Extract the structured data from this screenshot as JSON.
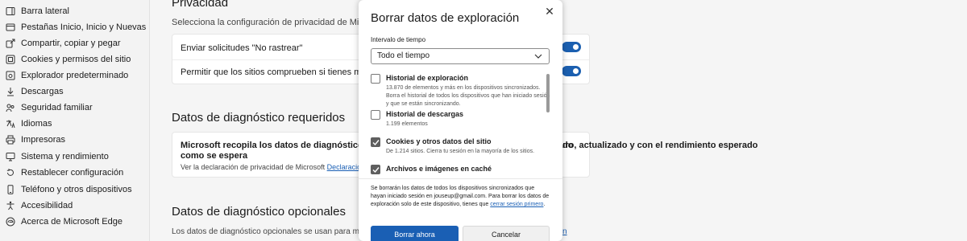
{
  "sidebar": {
    "items": [
      {
        "label": "Barra lateral",
        "icon": "sidebar-icon"
      },
      {
        "label": "Pestañas Inicio, Inicio y Nuevas",
        "icon": "home-icon"
      },
      {
        "label": "Compartir, copiar y pegar",
        "icon": "share-icon"
      },
      {
        "label": "Cookies y permisos del sitio",
        "icon": "cookie-icon"
      },
      {
        "label": "Explorador predeterminado",
        "icon": "browser-icon"
      },
      {
        "label": "Descargas",
        "icon": "download-icon"
      },
      {
        "label": "Seguridad familiar",
        "icon": "family-icon"
      },
      {
        "label": "Idiomas",
        "icon": "language-icon"
      },
      {
        "label": "Impresoras",
        "icon": "printer-icon"
      },
      {
        "label": "Sistema y rendimiento",
        "icon": "system-icon"
      },
      {
        "label": "Restablecer configuración",
        "icon": "reset-icon"
      },
      {
        "label": "Teléfono y otros dispositivos",
        "icon": "phone-icon"
      },
      {
        "label": "Accesibilidad",
        "icon": "accessibility-icon"
      },
      {
        "label": "Acerca de Microsoft Edge",
        "icon": "edge-icon"
      }
    ]
  },
  "main": {
    "privacy_title": "Privacidad",
    "privacy_sub": "Selecciona la configuración de privacidad de Microsoft Edge.",
    "dnt_label": "Enviar solicitudes \"No rastrear\"",
    "payment_label": "Permitir que los sitios comprueben si tienes métodos de pago guardados",
    "required_title": "Datos de diagnóstico requeridos",
    "required_text_1": "Microsoft recopila los datos de diagnóstico necesarios para mantener Microsoft Edge seguro, actualizado y con el rendimiento esperado",
    "required_text_2": "como se espera",
    "required_right": "do",
    "required_link_prefix": "Ver la declaración de privacidad de Microsoft",
    "required_link": "Declaración de privacidad",
    "optional_title": "Datos de diagnóstico opcionales",
    "optional_text": "Los datos de diagnóstico opcionales se usan para mejorar los productos de Microsoft",
    "optional_link": "n"
  },
  "dialog": {
    "title": "Borrar datos de exploración",
    "close_glyph": "✕",
    "interval_label": "Intervalo de tiempo",
    "interval_value": "Todo el tiempo",
    "options": [
      {
        "title": "Historial de exploración",
        "desc": "13.870 de elementos y más en los dispositivos sincronizados. Borra el historial de todos los dispositivos que han iniciado sesión y que se están sincronizando.",
        "checked": false
      },
      {
        "title": "Historial de descargas",
        "desc": "1.199 elementos",
        "checked": false
      },
      {
        "title": "Cookies y otros datos del sitio",
        "desc": "De 1.214 sitios. Cierra tu sesión en la mayoría de los sitios.",
        "checked": true
      },
      {
        "title": "Archivos e imágenes en caché",
        "desc": "",
        "checked": true
      }
    ],
    "note_text": "Se borrarán los datos de todos los dispositivos sincronizados que hayan iniciado sesión en jouseup@gmail.com. Para borrar los datos de exploración solo de este dispositivo, tienes que",
    "note_link": "cerrar sesión primero",
    "note_end": ".",
    "primary_button": "Borrar ahora",
    "secondary_button": "Cancelar"
  },
  "colors": {
    "accent": "#1a5fb4",
    "toggle_on": "#1b5fb0",
    "checkbox_checked": "#5f5f5f"
  }
}
